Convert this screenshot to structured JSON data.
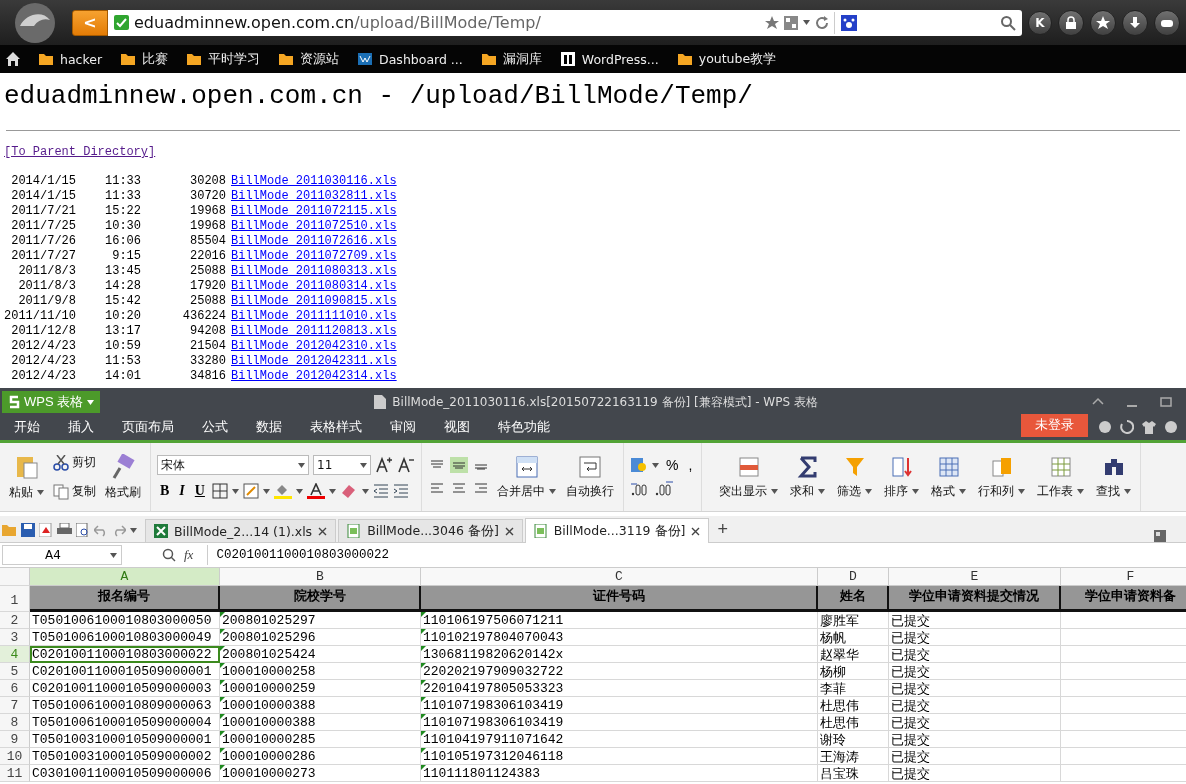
{
  "browser": {
    "back": "<",
    "url_host": "eduadminnew.open.com.cn",
    "url_path": "/upload/BillMode/Temp/",
    "profile": "K"
  },
  "bookmarks": [
    {
      "label": "hacker",
      "kind": "folder"
    },
    {
      "label": "比赛",
      "kind": "folder"
    },
    {
      "label": "平时学习",
      "kind": "folder"
    },
    {
      "label": "资源站",
      "kind": "folder"
    },
    {
      "label": "Dashboard ...",
      "kind": "site"
    },
    {
      "label": "漏洞库",
      "kind": "folder"
    },
    {
      "label": "WordPress...",
      "kind": "wp"
    },
    {
      "label": "youtube教学",
      "kind": "folder"
    }
  ],
  "page": {
    "heading": "eduadminnew.open.com.cn - /upload/BillMode/Temp/",
    "parent_link": "[To Parent Directory]",
    "files": [
      {
        "date": "2014/1/15",
        "time": "11:33",
        "size": "30208",
        "name": "BillMode_2011030116.xls"
      },
      {
        "date": "2014/1/15",
        "time": "11:33",
        "size": "30720",
        "name": "BillMode_2011032811.xls"
      },
      {
        "date": "2011/7/21",
        "time": "15:22",
        "size": "19968",
        "name": "BillMode_2011072115.xls"
      },
      {
        "date": "2011/7/25",
        "time": "10:30",
        "size": "19968",
        "name": "BillMode_2011072510.xls"
      },
      {
        "date": "2011/7/26",
        "time": "16:06",
        "size": "85504",
        "name": "BillMode_2011072616.xls"
      },
      {
        "date": "2011/7/27",
        "time": "9:15",
        "size": "22016",
        "name": "BillMode_2011072709.xls"
      },
      {
        "date": "2011/8/3",
        "time": "13:45",
        "size": "25088",
        "name": "BillMode_2011080313.xls"
      },
      {
        "date": "2011/8/3",
        "time": "14:28",
        "size": "17920",
        "name": "BillMode_2011080314.xls"
      },
      {
        "date": "2011/9/8",
        "time": "15:42",
        "size": "25088",
        "name": "BillMode_2011090815.xls"
      },
      {
        "date": "2011/11/10",
        "time": "10:20",
        "size": "436224",
        "name": "BillMode_2011111010.xls"
      },
      {
        "date": "2011/12/8",
        "time": "13:17",
        "size": "94208",
        "name": "BillMode_2011120813.xls"
      },
      {
        "date": "2012/4/23",
        "time": "10:59",
        "size": "21504",
        "name": "BillMode_2012042310.xls"
      },
      {
        "date": "2012/4/23",
        "time": "11:53",
        "size": "33280",
        "name": "BillMode_2012042311.xls"
      },
      {
        "date": "2012/4/23",
        "time": "14:01",
        "size": "34816",
        "name": "BillMode_2012042314.xls"
      }
    ]
  },
  "wps": {
    "app_button": "WPS 表格",
    "title": "BillMode_2011030116.xls[20150722163119 备份] [兼容模式] - WPS 表格",
    "tabs": [
      {
        "label": "开始",
        "selected": true
      },
      {
        "label": "插入",
        "selected": false
      },
      {
        "label": "页面布局",
        "selected": false
      },
      {
        "label": "公式",
        "selected": false
      },
      {
        "label": "数据",
        "selected": false
      },
      {
        "label": "表格样式",
        "selected": false
      },
      {
        "label": "审阅",
        "selected": false
      },
      {
        "label": "视图",
        "selected": false
      },
      {
        "label": "特色功能",
        "selected": false
      }
    ],
    "login": "未登录",
    "ribbon": {
      "paste": "粘贴",
      "cut": "剪切",
      "copy": "复制",
      "format_painter": "格式刷",
      "font": "宋体",
      "font_size": "11",
      "style_buttons": [
        "B",
        "I",
        "U"
      ],
      "merge": "合并居中",
      "wrap": "自动换行",
      "number_symbols": [
        "%",
        ","
      ],
      "commands": [
        "突出显示",
        "求和",
        "筛选",
        "排序",
        "格式",
        "行和列",
        "工作表",
        "查找"
      ]
    },
    "documents": [
      {
        "label": "BillMode_2...14 (1).xls",
        "kind": "xls",
        "selected": false
      },
      {
        "label": "BillMode...3046 备份]",
        "kind": "backup",
        "selected": false
      },
      {
        "label": "BillMode...3119 备份]",
        "kind": "backup",
        "selected": true
      }
    ],
    "new_tab": "+",
    "name_box": "A4",
    "fx": "fx",
    "formula": "C0201001100010803000022",
    "columns": [
      {
        "letter": "A",
        "header": "报名编号",
        "selected": true
      },
      {
        "letter": "B",
        "header": "院校学号",
        "selected": false,
        "text_flag": true
      },
      {
        "letter": "C",
        "header": "证件号码",
        "selected": false,
        "text_flag": true
      },
      {
        "letter": "D",
        "header": "姓名",
        "selected": false
      },
      {
        "letter": "E",
        "header": "学位申请资料提交情况",
        "selected": false
      },
      {
        "letter": "F",
        "header": "学位申请资料备",
        "selected": false
      }
    ],
    "header_row": "1",
    "rows": [
      {
        "number": "2",
        "selected": false,
        "cells": [
          "T0501006100010803000050",
          "200801025297",
          "110106197506071211",
          "廖胜军",
          "已提交"
        ]
      },
      {
        "number": "3",
        "selected": false,
        "cells": [
          "T0501006100010803000049",
          "200801025296",
          "110102197804070043",
          "杨帆",
          "已提交"
        ]
      },
      {
        "number": "4",
        "selected": true,
        "cells": [
          "C0201001100010803000022",
          "200801025424",
          "13068119820620142x",
          "赵翠华",
          "已提交"
        ]
      },
      {
        "number": "5",
        "selected": false,
        "cells": [
          "C0201001100010509000001",
          "100010000258",
          "220202197909032722",
          "杨柳",
          "已提交"
        ]
      },
      {
        "number": "6",
        "selected": false,
        "cells": [
          "C0201001100010509000003",
          "100010000259",
          "220104197805053323",
          "李菲",
          "已提交"
        ]
      },
      {
        "number": "7",
        "selected": false,
        "cells": [
          "T0501006100010809000063",
          "100010000388",
          "110107198306103419",
          "杜思伟",
          "已提交"
        ]
      },
      {
        "number": "8",
        "selected": false,
        "cells": [
          "T0501006100010509000004",
          "100010000388",
          "110107198306103419",
          "杜思伟",
          "已提交"
        ]
      },
      {
        "number": "9",
        "selected": false,
        "cells": [
          "T0501003100010509000001",
          "100010000285",
          "110104197911071642",
          "谢玲",
          "已提交"
        ]
      },
      {
        "number": "10",
        "selected": false,
        "cells": [
          "T0501003100010509000002",
          "100010000286",
          "110105197312046118",
          "王海涛",
          "已提交"
        ]
      },
      {
        "number": "11",
        "selected": false,
        "cells": [
          "C0301001100010509000006",
          "100010000273",
          "110111801124383",
          "吕宝珠",
          "已提交"
        ]
      }
    ]
  }
}
